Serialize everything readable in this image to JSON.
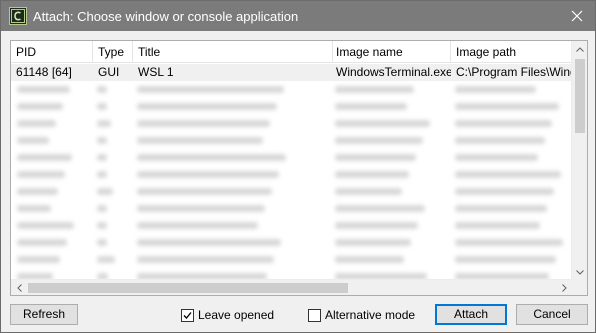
{
  "window": {
    "title": "Attach: Choose window or console application",
    "icon": "app-icon",
    "close_icon": "close-icon"
  },
  "columns": [
    "PID",
    "Type",
    "Title",
    "Image name",
    "Image path"
  ],
  "rows": [
    {
      "pid": "61148 [64]",
      "type": "GUI",
      "title": "WSL 1",
      "image_name": "WindowsTerminal.exe",
      "image_path": "C:\\Program Files\\Window"
    }
  ],
  "buttons": {
    "refresh": "Refresh",
    "attach": "Attach",
    "cancel": "Cancel"
  },
  "checks": {
    "leave_opened": {
      "label": "Leave opened",
      "checked": true
    },
    "alternative_mode": {
      "label": "Alternative mode",
      "checked": false
    }
  }
}
